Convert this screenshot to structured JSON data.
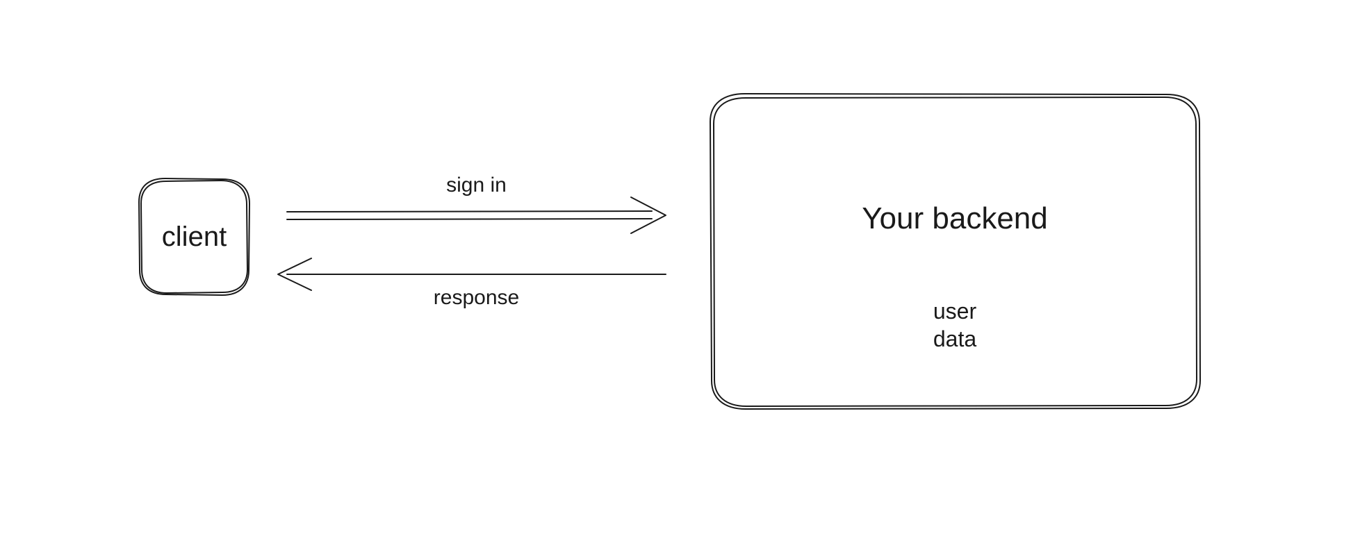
{
  "client": {
    "label": "client"
  },
  "backend": {
    "title": "Your backend",
    "data_line1": "user",
    "data_line2": "data"
  },
  "arrows": {
    "top_label": "sign in",
    "bottom_label": "response"
  }
}
